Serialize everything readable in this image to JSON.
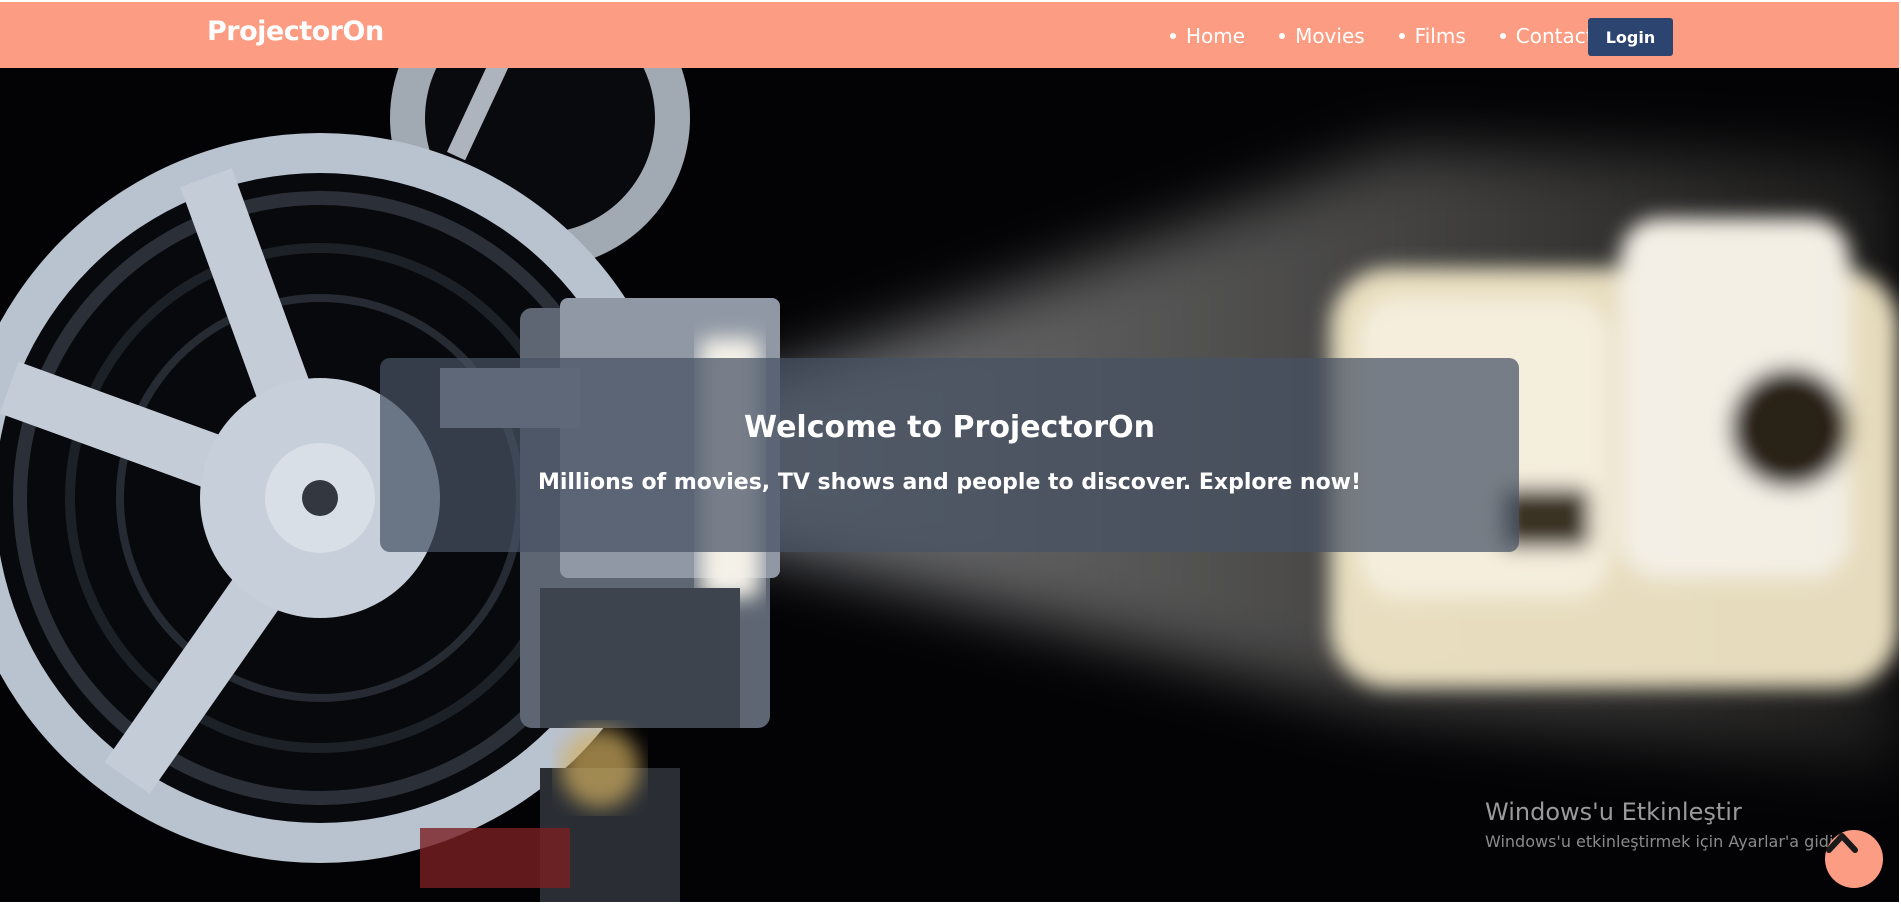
{
  "navbar": {
    "brand": "ProjectorOn",
    "links": [
      {
        "label": "Home"
      },
      {
        "label": "Movies"
      },
      {
        "label": "Films"
      },
      {
        "label": "Contact"
      }
    ],
    "login_label": "Login"
  },
  "hero": {
    "title": "Welcome to ProjectorOn",
    "subtitle": "Millions of movies, TV shows and people to discover. Explore now!"
  },
  "windows_watermark": {
    "title": "Windows'u Etkinleştir",
    "subtitle": "Windows'u etkinleştirmek için Ayarlar'a gidin."
  },
  "icons": {
    "scroll_top": "chevron-up-icon"
  },
  "colors": {
    "navbar_bg": "#fc9c82",
    "login_bg": "#2c4470",
    "scroll_top_bg": "#fc9c82"
  }
}
